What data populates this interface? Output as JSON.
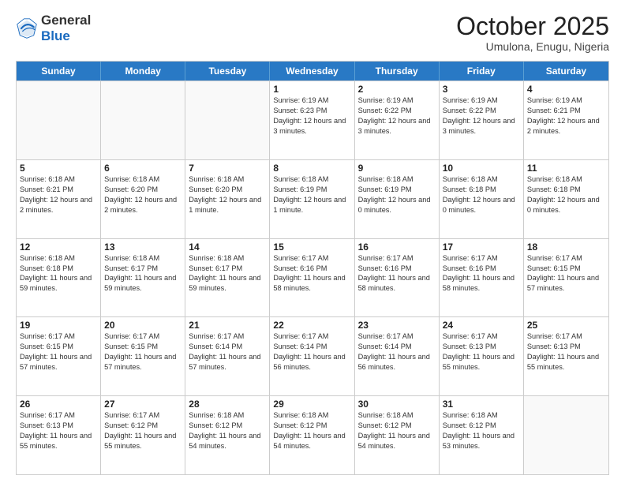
{
  "header": {
    "logo_general": "General",
    "logo_blue": "Blue",
    "month_title": "October 2025",
    "subtitle": "Umulona, Enugu, Nigeria"
  },
  "days_of_week": [
    "Sunday",
    "Monday",
    "Tuesday",
    "Wednesday",
    "Thursday",
    "Friday",
    "Saturday"
  ],
  "weeks": [
    [
      {
        "day": "",
        "empty": true
      },
      {
        "day": "",
        "empty": true
      },
      {
        "day": "",
        "empty": true
      },
      {
        "day": "1",
        "sunrise": "Sunrise: 6:19 AM",
        "sunset": "Sunset: 6:23 PM",
        "daylight": "Daylight: 12 hours and 3 minutes."
      },
      {
        "day": "2",
        "sunrise": "Sunrise: 6:19 AM",
        "sunset": "Sunset: 6:22 PM",
        "daylight": "Daylight: 12 hours and 3 minutes."
      },
      {
        "day": "3",
        "sunrise": "Sunrise: 6:19 AM",
        "sunset": "Sunset: 6:22 PM",
        "daylight": "Daylight: 12 hours and 3 minutes."
      },
      {
        "day": "4",
        "sunrise": "Sunrise: 6:19 AM",
        "sunset": "Sunset: 6:21 PM",
        "daylight": "Daylight: 12 hours and 2 minutes."
      }
    ],
    [
      {
        "day": "5",
        "sunrise": "Sunrise: 6:18 AM",
        "sunset": "Sunset: 6:21 PM",
        "daylight": "Daylight: 12 hours and 2 minutes."
      },
      {
        "day": "6",
        "sunrise": "Sunrise: 6:18 AM",
        "sunset": "Sunset: 6:20 PM",
        "daylight": "Daylight: 12 hours and 2 minutes."
      },
      {
        "day": "7",
        "sunrise": "Sunrise: 6:18 AM",
        "sunset": "Sunset: 6:20 PM",
        "daylight": "Daylight: 12 hours and 1 minute."
      },
      {
        "day": "8",
        "sunrise": "Sunrise: 6:18 AM",
        "sunset": "Sunset: 6:19 PM",
        "daylight": "Daylight: 12 hours and 1 minute."
      },
      {
        "day": "9",
        "sunrise": "Sunrise: 6:18 AM",
        "sunset": "Sunset: 6:19 PM",
        "daylight": "Daylight: 12 hours and 0 minutes."
      },
      {
        "day": "10",
        "sunrise": "Sunrise: 6:18 AM",
        "sunset": "Sunset: 6:18 PM",
        "daylight": "Daylight: 12 hours and 0 minutes."
      },
      {
        "day": "11",
        "sunrise": "Sunrise: 6:18 AM",
        "sunset": "Sunset: 6:18 PM",
        "daylight": "Daylight: 12 hours and 0 minutes."
      }
    ],
    [
      {
        "day": "12",
        "sunrise": "Sunrise: 6:18 AM",
        "sunset": "Sunset: 6:18 PM",
        "daylight": "Daylight: 11 hours and 59 minutes."
      },
      {
        "day": "13",
        "sunrise": "Sunrise: 6:18 AM",
        "sunset": "Sunset: 6:17 PM",
        "daylight": "Daylight: 11 hours and 59 minutes."
      },
      {
        "day": "14",
        "sunrise": "Sunrise: 6:18 AM",
        "sunset": "Sunset: 6:17 PM",
        "daylight": "Daylight: 11 hours and 59 minutes."
      },
      {
        "day": "15",
        "sunrise": "Sunrise: 6:17 AM",
        "sunset": "Sunset: 6:16 PM",
        "daylight": "Daylight: 11 hours and 58 minutes."
      },
      {
        "day": "16",
        "sunrise": "Sunrise: 6:17 AM",
        "sunset": "Sunset: 6:16 PM",
        "daylight": "Daylight: 11 hours and 58 minutes."
      },
      {
        "day": "17",
        "sunrise": "Sunrise: 6:17 AM",
        "sunset": "Sunset: 6:16 PM",
        "daylight": "Daylight: 11 hours and 58 minutes."
      },
      {
        "day": "18",
        "sunrise": "Sunrise: 6:17 AM",
        "sunset": "Sunset: 6:15 PM",
        "daylight": "Daylight: 11 hours and 57 minutes."
      }
    ],
    [
      {
        "day": "19",
        "sunrise": "Sunrise: 6:17 AM",
        "sunset": "Sunset: 6:15 PM",
        "daylight": "Daylight: 11 hours and 57 minutes."
      },
      {
        "day": "20",
        "sunrise": "Sunrise: 6:17 AM",
        "sunset": "Sunset: 6:15 PM",
        "daylight": "Daylight: 11 hours and 57 minutes."
      },
      {
        "day": "21",
        "sunrise": "Sunrise: 6:17 AM",
        "sunset": "Sunset: 6:14 PM",
        "daylight": "Daylight: 11 hours and 57 minutes."
      },
      {
        "day": "22",
        "sunrise": "Sunrise: 6:17 AM",
        "sunset": "Sunset: 6:14 PM",
        "daylight": "Daylight: 11 hours and 56 minutes."
      },
      {
        "day": "23",
        "sunrise": "Sunrise: 6:17 AM",
        "sunset": "Sunset: 6:14 PM",
        "daylight": "Daylight: 11 hours and 56 minutes."
      },
      {
        "day": "24",
        "sunrise": "Sunrise: 6:17 AM",
        "sunset": "Sunset: 6:13 PM",
        "daylight": "Daylight: 11 hours and 55 minutes."
      },
      {
        "day": "25",
        "sunrise": "Sunrise: 6:17 AM",
        "sunset": "Sunset: 6:13 PM",
        "daylight": "Daylight: 11 hours and 55 minutes."
      }
    ],
    [
      {
        "day": "26",
        "sunrise": "Sunrise: 6:17 AM",
        "sunset": "Sunset: 6:13 PM",
        "daylight": "Daylight: 11 hours and 55 minutes."
      },
      {
        "day": "27",
        "sunrise": "Sunrise: 6:17 AM",
        "sunset": "Sunset: 6:12 PM",
        "daylight": "Daylight: 11 hours and 55 minutes."
      },
      {
        "day": "28",
        "sunrise": "Sunrise: 6:18 AM",
        "sunset": "Sunset: 6:12 PM",
        "daylight": "Daylight: 11 hours and 54 minutes."
      },
      {
        "day": "29",
        "sunrise": "Sunrise: 6:18 AM",
        "sunset": "Sunset: 6:12 PM",
        "daylight": "Daylight: 11 hours and 54 minutes."
      },
      {
        "day": "30",
        "sunrise": "Sunrise: 6:18 AM",
        "sunset": "Sunset: 6:12 PM",
        "daylight": "Daylight: 11 hours and 54 minutes."
      },
      {
        "day": "31",
        "sunrise": "Sunrise: 6:18 AM",
        "sunset": "Sunset: 6:12 PM",
        "daylight": "Daylight: 11 hours and 53 minutes."
      },
      {
        "day": "",
        "empty": true
      }
    ]
  ]
}
